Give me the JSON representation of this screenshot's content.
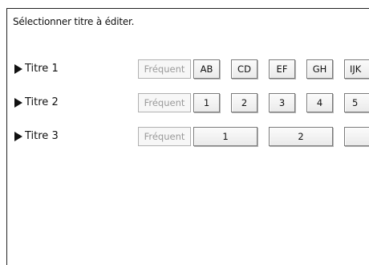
{
  "instruction": "Sélectionner titre à éditer.",
  "rows": [
    {
      "label": "Titre 1",
      "frequent": "Fréquent",
      "buttons": [
        "AB",
        "CD",
        "EF",
        "GH",
        "IJK"
      ]
    },
    {
      "label": "Titre 2",
      "frequent": "Fréquent",
      "buttons": [
        "1",
        "2",
        "3",
        "4",
        "5"
      ]
    },
    {
      "label": "Titre 3",
      "frequent": "Fréquent",
      "buttons": [
        "1",
        "2",
        ""
      ]
    }
  ]
}
